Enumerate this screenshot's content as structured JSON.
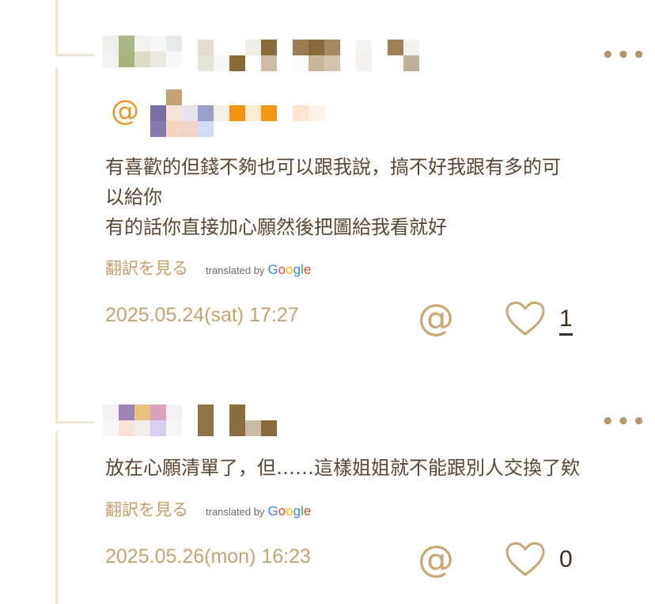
{
  "colors": {
    "accent": "#c0a06d",
    "text": "#5a4632",
    "mention": "#e89a2a"
  },
  "icons": {
    "more": "more-horizontal-icon",
    "mention": "at-sign-icon",
    "like": "heart-outline-icon"
  },
  "comments": [
    {
      "more_label": "•••",
      "reply_mention_symbol": "@",
      "text_lines": [
        "有喜歡的但錢不夠也可以跟我說，搞不好我跟有多的可",
        "以給你",
        "有的話你直接加心願然後把圖給我看就好"
      ],
      "translate_label": "翻訳を見る",
      "translated_by": "translated by",
      "google": [
        "G",
        "o",
        "o",
        "g",
        "l",
        "e"
      ],
      "timestamp": "2025.05.24(sat) 17:27",
      "mention_button": "@",
      "like_count": "1"
    },
    {
      "more_label": "•••",
      "text_lines": [
        "放在心願清單了，但……這樣姐姐就不能跟別人交換了欸"
      ],
      "translate_label": "翻訳を見る",
      "translated_by": "translated by",
      "google": [
        "G",
        "o",
        "o",
        "g",
        "l",
        "e"
      ],
      "timestamp": "2025.05.26(mon) 16:23",
      "mention_button": "@",
      "like_count": "0"
    }
  ]
}
